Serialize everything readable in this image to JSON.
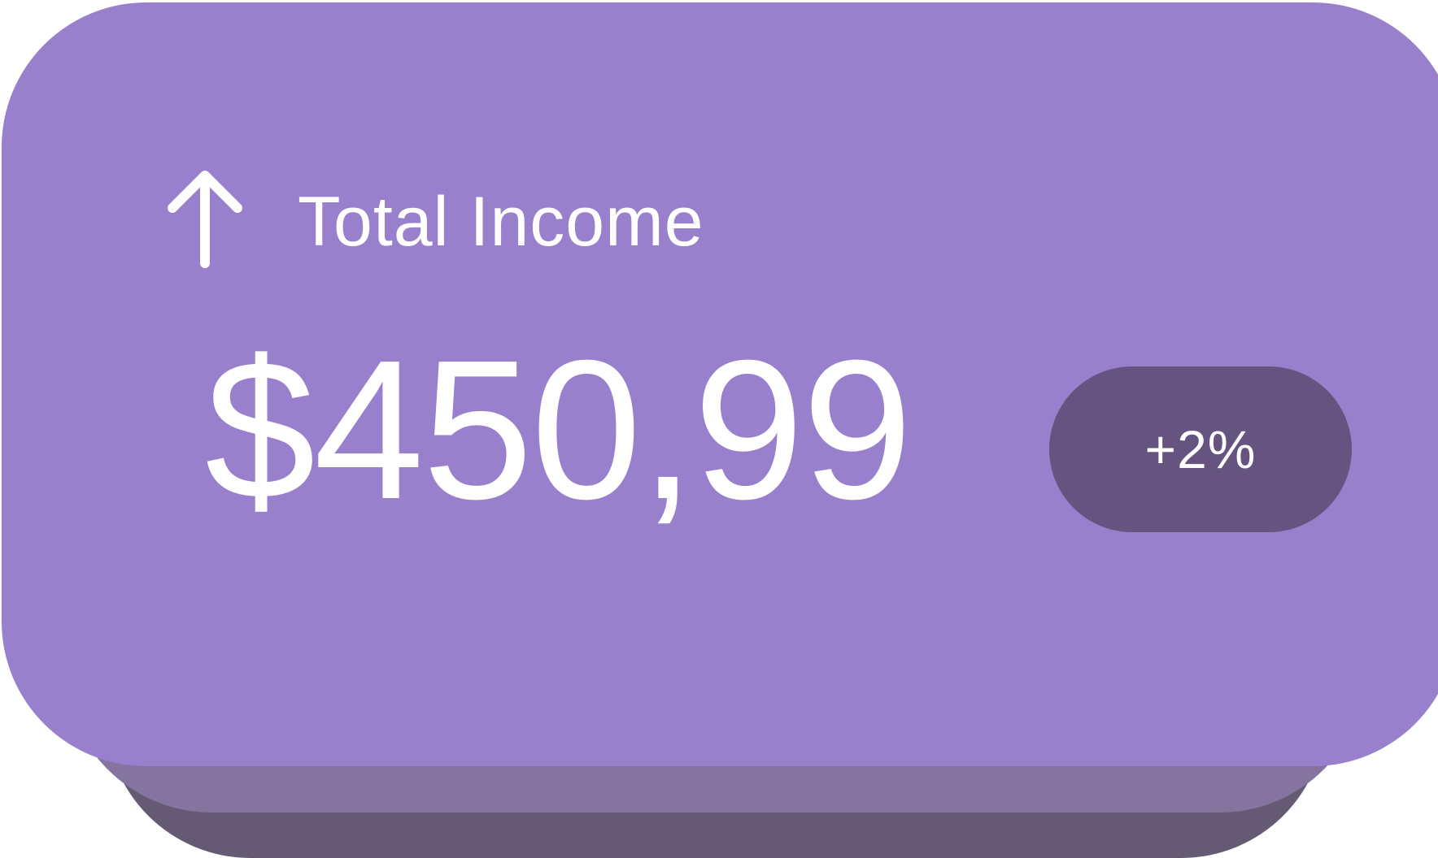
{
  "card": {
    "title": "Total Income",
    "amount": "$450,99",
    "change_badge": "+2%",
    "icon": "arrow-up-icon"
  },
  "colors": {
    "card_background": "#9880CD",
    "stack_middle": "#84749F",
    "stack_back": "#645A74",
    "badge_background": "#64547F",
    "text": "#FFFFFF"
  }
}
